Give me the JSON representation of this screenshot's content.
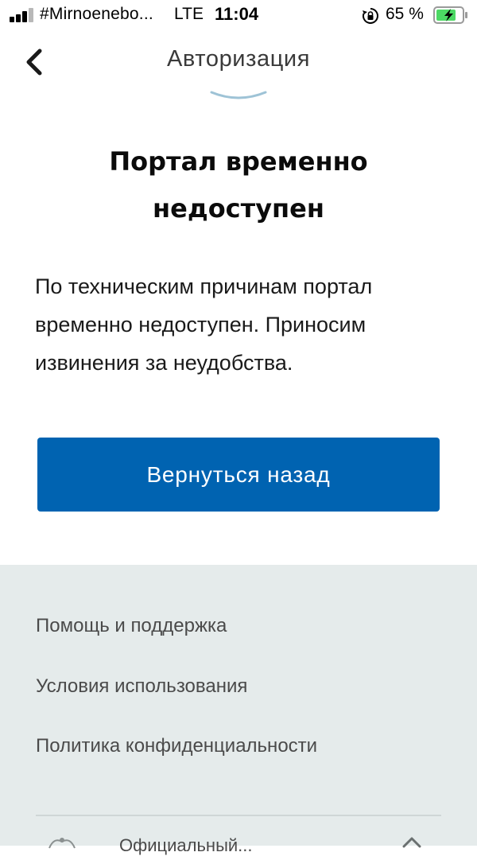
{
  "status_bar": {
    "carrier": "#Mirnoenebo...",
    "network": "LTE",
    "time": "11:04",
    "battery_percent": "65 %"
  },
  "nav": {
    "title": "Авторизация",
    "back_icon": "chevron-left-icon"
  },
  "content": {
    "title_line1": "Портал временно",
    "title_line2": "недоступен",
    "message_line1": "По техническим причинам портал",
    "message_line2": "временно недоступен. Приносим",
    "message_line3": "извинения за неудобства.",
    "back_button_label": "Вернуться назад"
  },
  "footer": {
    "links": [
      {
        "label": "Помощь и поддержка"
      },
      {
        "label": "Условия использования"
      },
      {
        "label": "Политика конфиденциальности"
      }
    ],
    "bottom_text": "Официальный..."
  },
  "colors": {
    "primary": "#0063b1",
    "footer_bg": "#e5ebeb",
    "battery_fill": "#4cd964"
  }
}
